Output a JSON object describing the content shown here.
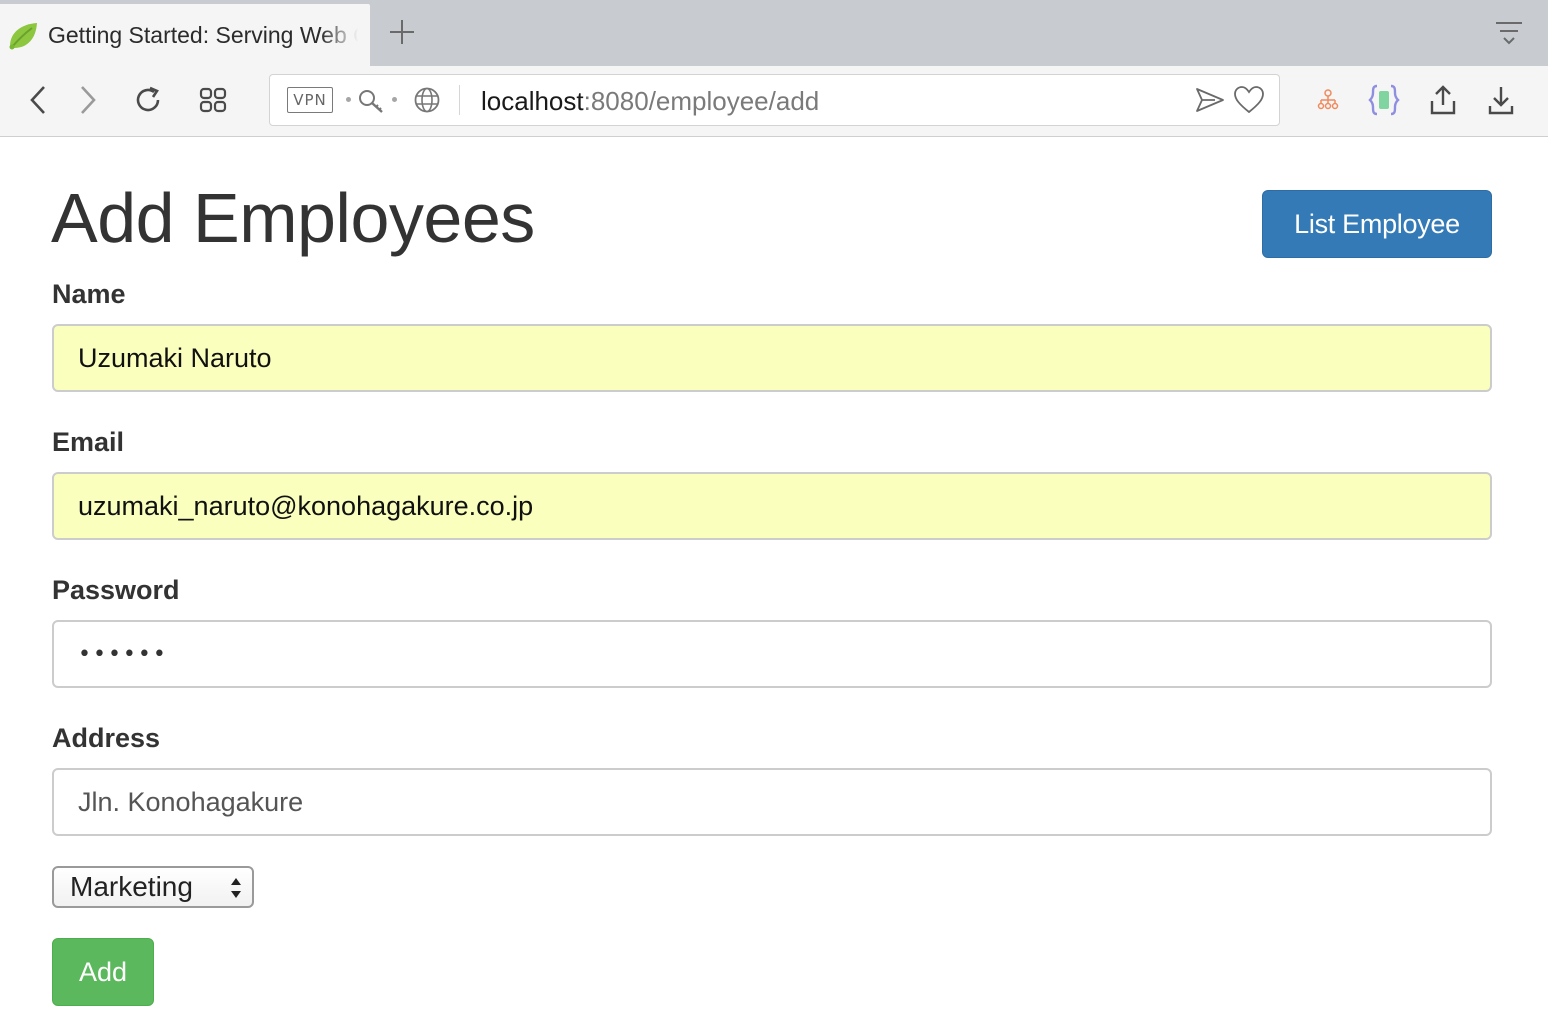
{
  "browser": {
    "tab_title": "Getting Started: Serving Web Content",
    "url_host": "localhost",
    "url_rest": ":8080/employee/add",
    "vpn_label": "VPN"
  },
  "page": {
    "title": "Add Employees",
    "list_button_label": "List Employee",
    "add_button_label": "Add"
  },
  "form": {
    "name": {
      "label": "Name",
      "value": "Uzumaki Naruto",
      "autofilled": true
    },
    "email": {
      "label": "Email",
      "value": "uzumaki_naruto@konohagakure.co.jp",
      "autofilled": true
    },
    "password": {
      "label": "Password",
      "value": "••••••"
    },
    "address": {
      "label": "Address",
      "value": "Jln. Konohagakure"
    },
    "department": {
      "selected": "Marketing"
    }
  },
  "colors": {
    "primary_button": "#337ab7",
    "success_button": "#5cb85c",
    "autofill_background": "#faffbd"
  }
}
